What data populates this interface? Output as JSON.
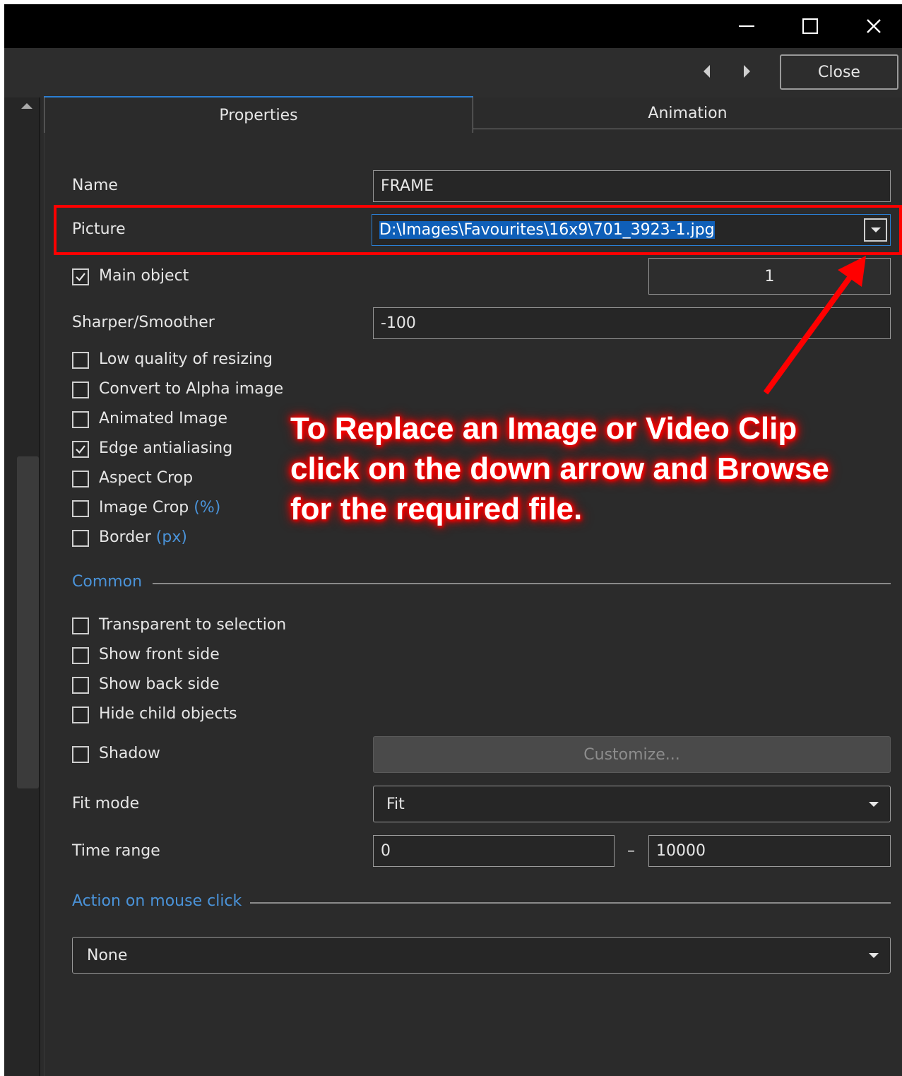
{
  "window": {
    "controls": {
      "minimize": "—",
      "maximize": "☐",
      "close": "✕"
    }
  },
  "toolbar": {
    "prev_icon": "caret-left-icon",
    "next_icon": "caret-right-icon",
    "close_label": "Close"
  },
  "tabs": [
    {
      "label": "Properties",
      "active": true
    },
    {
      "label": "Animation",
      "active": false
    }
  ],
  "properties": {
    "name_label": "Name",
    "name_value": "FRAME",
    "picture_label": "Picture",
    "picture_value": "D:\\Images\\Favourites\\16x9\\701_3923-1.jpg",
    "main_object_label": "Main object",
    "main_object_checked": true,
    "main_object_value": "1",
    "sharper_label": "Sharper/Smoother",
    "sharper_value": "-100",
    "options": [
      {
        "label": "Low quality of resizing",
        "suffix": "",
        "checked": false
      },
      {
        "label": "Convert to Alpha image",
        "suffix": "",
        "checked": false
      },
      {
        "label": "Animated Image",
        "suffix": "",
        "checked": false
      },
      {
        "label": "Edge antialiasing",
        "suffix": "",
        "checked": true
      },
      {
        "label": "Aspect Crop",
        "suffix": "",
        "checked": false
      },
      {
        "label": "Image Crop",
        "suffix": "(%)",
        "checked": false
      },
      {
        "label": "Border",
        "suffix": "(px)",
        "checked": false
      }
    ]
  },
  "common": {
    "title": "Common",
    "options": [
      {
        "label": "Transparent to selection",
        "checked": false
      },
      {
        "label": "Show front side",
        "checked": false
      },
      {
        "label": "Show back side",
        "checked": false
      },
      {
        "label": "Hide child objects",
        "checked": false
      }
    ],
    "shadow_label": "Shadow",
    "shadow_checked": false,
    "customize_label": "Customize...",
    "fit_mode_label": "Fit mode",
    "fit_mode_value": "Fit",
    "time_range_label": "Time range",
    "time_range_from": "0",
    "time_range_sep": "–",
    "time_range_to": "10000"
  },
  "mouse_action": {
    "title": "Action on mouse click",
    "value": "None"
  },
  "annotation": {
    "lines": [
      "To Replace an Image or Video Clip",
      "click on the down arrow and Browse",
      "for the required file."
    ],
    "color": "#ff0000"
  },
  "colors": {
    "background": "#2b2b2b",
    "accent": "#2a7fd4",
    "section": "#4a93d9",
    "highlight": "#0f5fb8",
    "annotation_red": "#ff0000"
  }
}
